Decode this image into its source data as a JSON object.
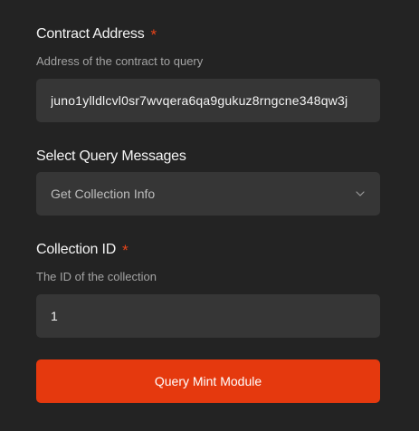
{
  "contract_address": {
    "label": "Contract Address",
    "required_marker": "*",
    "help_text": "Address of the contract to query",
    "value": "juno1ylldlcvl0sr7wvqera6qa9gukuz8rngcne348qw3j"
  },
  "query_messages": {
    "label": "Select Query Messages",
    "selected": "Get Collection Info",
    "icon": "chevron-down-icon"
  },
  "collection_id": {
    "label": "Collection ID",
    "required_marker": "*",
    "help_text": "The ID of the collection",
    "value": "1"
  },
  "submit": {
    "label": "Query Mint Module"
  },
  "colors": {
    "background": "#232323",
    "field_background": "#363636",
    "accent": "#e5390e",
    "required": "#e8441a"
  }
}
